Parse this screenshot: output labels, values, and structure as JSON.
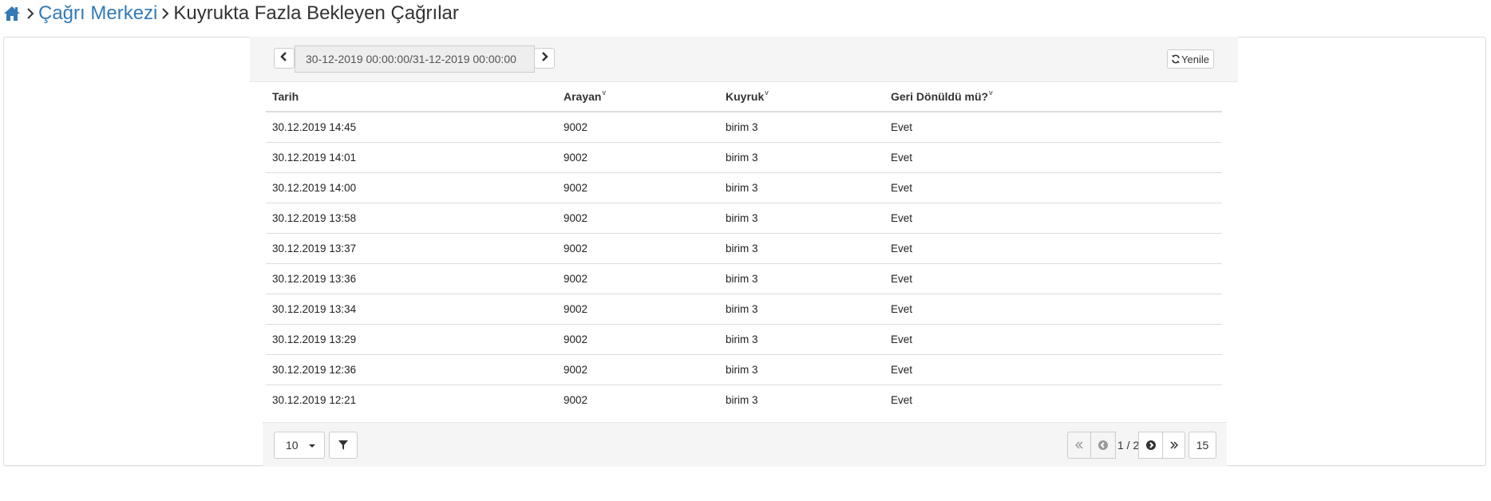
{
  "breadcrumb": {
    "home_icon": "home-icon",
    "separator_icon": "chevron-right-icon",
    "parent": "Çağrı Merkezi",
    "current": "Kuyrukta Fazla Bekleyen Çağrılar"
  },
  "toolbar": {
    "date_range": "30-12-2019 00:00:00/31-12-2019 00:00:00",
    "prev_icon": "chevron-left-icon",
    "next_icon": "chevron-right-icon",
    "refresh_icon": "refresh-icon",
    "refresh_label": "Yenile"
  },
  "table": {
    "sort_marker": "v",
    "columns": [
      "Tarih",
      "Arayan",
      "Kuyruk",
      "Geri Dönüldü mü?"
    ],
    "rows": [
      [
        "30.12.2019 14:45",
        "9002",
        "birim 3",
        "Evet"
      ],
      [
        "30.12.2019 14:01",
        "9002",
        "birim 3",
        "Evet"
      ],
      [
        "30.12.2019 14:00",
        "9002",
        "birim 3",
        "Evet"
      ],
      [
        "30.12.2019 13:58",
        "9002",
        "birim 3",
        "Evet"
      ],
      [
        "30.12.2019 13:37",
        "9002",
        "birim 3",
        "Evet"
      ],
      [
        "30.12.2019 13:36",
        "9002",
        "birim 3",
        "Evet"
      ],
      [
        "30.12.2019 13:34",
        "9002",
        "birim 3",
        "Evet"
      ],
      [
        "30.12.2019 13:29",
        "9002",
        "birim 3",
        "Evet"
      ],
      [
        "30.12.2019 12:36",
        "9002",
        "birim 3",
        "Evet"
      ],
      [
        "30.12.2019 12:21",
        "9002",
        "birim 3",
        "Evet"
      ]
    ]
  },
  "footer": {
    "page_size": "10",
    "filter_icon": "filter-icon",
    "first_icon": "double-chevron-left-icon",
    "prev_icon": "circle-chevron-left-icon",
    "page_info": "1 / 2",
    "next_icon": "circle-chevron-right-icon",
    "last_icon": "double-chevron-right-icon",
    "total": "15"
  }
}
